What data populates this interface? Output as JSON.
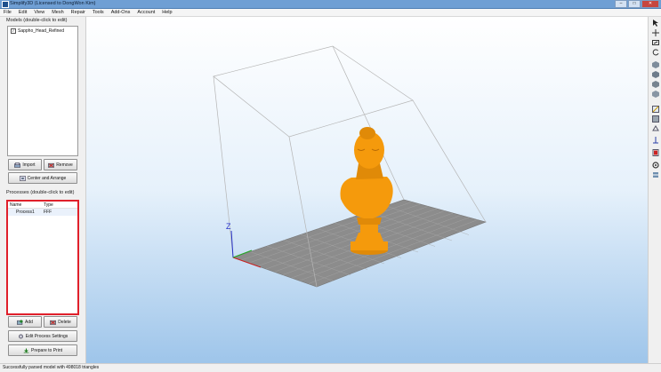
{
  "window": {
    "title": "Simplify3D (Licensed to DongWon Kim)",
    "min": "–",
    "max": "□",
    "close": "✕"
  },
  "menu": [
    "File",
    "Edit",
    "View",
    "Mesh",
    "Repair",
    "Tools",
    "Add-Ons",
    "Account",
    "Help"
  ],
  "models": {
    "label": "Models (double-click to edit)",
    "items": [
      {
        "name": "Sappho_Head_Refined",
        "checked": true
      }
    ],
    "import_label": "Import",
    "remove_label": "Remove",
    "center_label": "Center and Arrange"
  },
  "processes": {
    "label": "Processes (double-click to edit)",
    "columns": [
      "Name",
      "Type"
    ],
    "rows": [
      {
        "name": "Process1",
        "type": "FFF"
      }
    ],
    "add_label": "Add",
    "delete_label": "Delete",
    "edit_label": "Edit Process Settings",
    "prepare_label": "Prepare to Print"
  },
  "viewport": {
    "z_axis_label": "Z",
    "model_color": "#f59a0c",
    "bed_color": "#8c8c8c"
  },
  "right_tools": [
    "select-tool-icon",
    "move-tool-icon",
    "scale-tool-icon",
    "rotate-tool-icon",
    "view-iso-icon",
    "view-front-icon",
    "view-side-icon",
    "view-top-icon",
    "cross-section-icon",
    "box-view-icon",
    "supports-icon",
    "zero-z-icon",
    "toolpath-icon",
    "settings-gear-icon",
    "layers-icon"
  ],
  "status": {
    "text": "Successfully parsed model with 498018 triangles"
  },
  "colors": {
    "highlight_border": "#e0202b",
    "titlebar": "#6f9fd4"
  }
}
